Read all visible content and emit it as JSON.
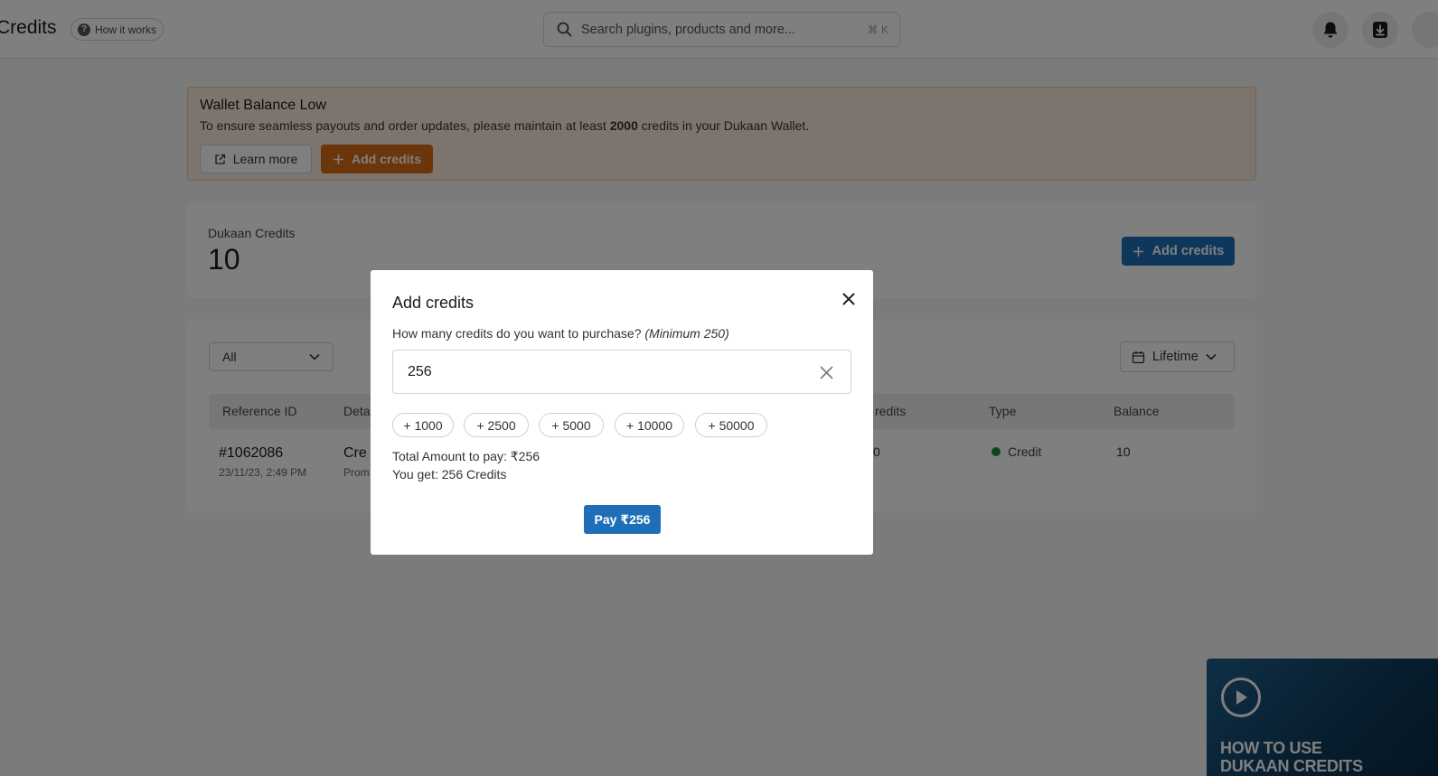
{
  "header": {
    "title": "Credits",
    "how_it_works": "How it works",
    "search_placeholder": "Search plugins, products and more...",
    "search_shortcut": "⌘ K"
  },
  "alert": {
    "title": "Wallet Balance Low",
    "desc_prefix": "To ensure seamless payouts and order updates, please maintain at least ",
    "desc_amount": "2000",
    "desc_suffix": " credits in your Dukaan Wallet.",
    "learn_more": "Learn more",
    "add_credits": "Add credits"
  },
  "credits_card": {
    "label": "Dukaan Credits",
    "value": "10",
    "add_credits": "Add credits"
  },
  "transactions": {
    "filter_value": "All",
    "period_value": "Lifetime",
    "columns": [
      "Reference ID",
      "Deta",
      "redits",
      "Type",
      "Balance"
    ],
    "row": {
      "reference_id": "#1062086",
      "date": "23/11/23, 2:49 PM",
      "detail": "Cre",
      "detail_sub": "Prom",
      "credits": "0",
      "type": "Credit",
      "balance": "10"
    }
  },
  "modal": {
    "title": "Add credits",
    "question": "How many credits do you want to purchase?",
    "question_note": "(Minimum 250)",
    "input_value": "256",
    "chips": [
      "+ 1000",
      "+ 2500",
      "+ 5000",
      "+ 10000",
      "+ 50000"
    ],
    "total_line": "Total Amount to pay: ₹256",
    "get_line": "You get: 256 Credits",
    "pay_button": "Pay ₹256"
  },
  "promo": {
    "text_line1": "HOW TO USE",
    "text_line2": "DUKAAN CREDITS"
  },
  "colors": {
    "primary_blue": "#1e6fb8",
    "alert_orange": "#d96d18",
    "alert_bg": "#faeada",
    "credit_green": "#1c8a2f"
  }
}
